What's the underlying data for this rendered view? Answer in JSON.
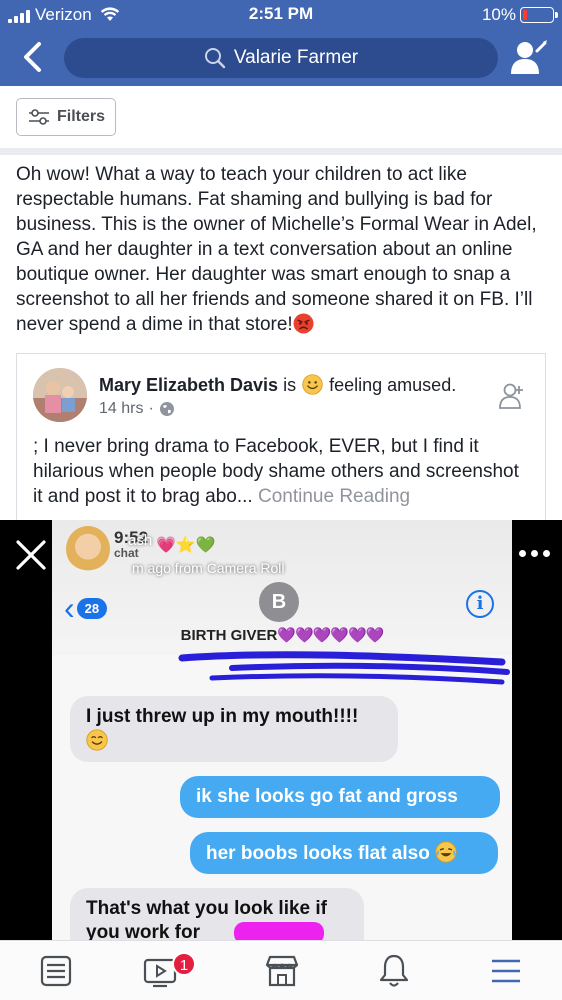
{
  "status_bar": {
    "carrier": "Verizon",
    "time": "2:51 PM",
    "battery": "10%"
  },
  "header": {
    "search_value": "Valarie Farmer",
    "icons": [
      "back-arrow-icon",
      "search-icon",
      "add-friend-icon"
    ]
  },
  "filters": {
    "label": "Filters"
  },
  "post": {
    "text": "Oh wow! What a way to teach your children to act like respectable humans. Fat shaming and bullying is bad for business. This is the owner of Michelle’s Formal Wear in Adel, GA and her daughter in a text conversation about an online boutique owner. Her daughter was smart enough to snap a screenshot to all her friends and someone shared it on FB. I’ll never spend a dime in that store!",
    "emoji": "angry-face-emoji"
  },
  "shared_post": {
    "author": "Mary Elizabeth Davis",
    "is_text": "is",
    "feeling_text": "feeling amused.",
    "time": "14 hrs",
    "privacy_icon": "globe-icon",
    "text": "; I never bring drama to Facebook, EVER, but I find it hilarious when people body shame others and screenshot it and post it to brag abo...",
    "continue_label": "Continue Reading"
  },
  "screenshot": {
    "time": "9:52",
    "chat_label": "chat",
    "caption": "ash",
    "sub_caption": "m ago from Camera Roll",
    "back_count": "28",
    "contact_initial": "B",
    "contact_name": "BIRTH GIVER",
    "contact_hearts": "💜💜💜💜💜💜",
    "messages": [
      {
        "direction": "in",
        "text": "I just threw up in my mouth!!!!"
      },
      {
        "direction": "out",
        "text": "ik she looks go fat and gross"
      },
      {
        "direction": "out",
        "text": "her boobs looks flat also"
      },
      {
        "direction": "in",
        "text": "That's what you look like if you work for"
      }
    ]
  },
  "tab_bar": {
    "tabs": [
      "news-feed-icon",
      "watch-icon",
      "marketplace-icon",
      "notifications-icon",
      "menu-icon"
    ],
    "watch_badge": "1"
  },
  "colors": {
    "header_blue": "#4267b2",
    "search_pill": "#2d4c8f",
    "link_gray": "#90949c",
    "imessage_blue": "#45aaf2",
    "badge_red": "#e41e3f"
  }
}
